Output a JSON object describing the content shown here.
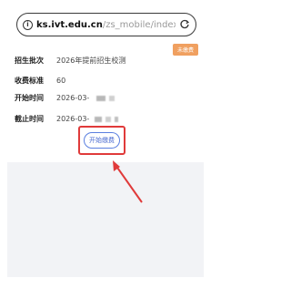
{
  "browser": {
    "url_host": "ks.ivt.edu.cn",
    "url_path": "/zs_mobile/index.html#/j"
  },
  "status_badge": "未缴费",
  "fields": {
    "batch_label": "招生批次",
    "batch_value": "2026年提前招生校测",
    "fee_label": "收费标准",
    "fee_value": "60",
    "start_label": "开始时间",
    "start_value": "2026-03-",
    "end_label": "截止时间",
    "end_value": "2026-03-"
  },
  "pay_button": "开始缴费",
  "colors": {
    "highlight": "#e03a3a",
    "button_accent": "#4a6ad0",
    "badge": "#f0a060"
  }
}
